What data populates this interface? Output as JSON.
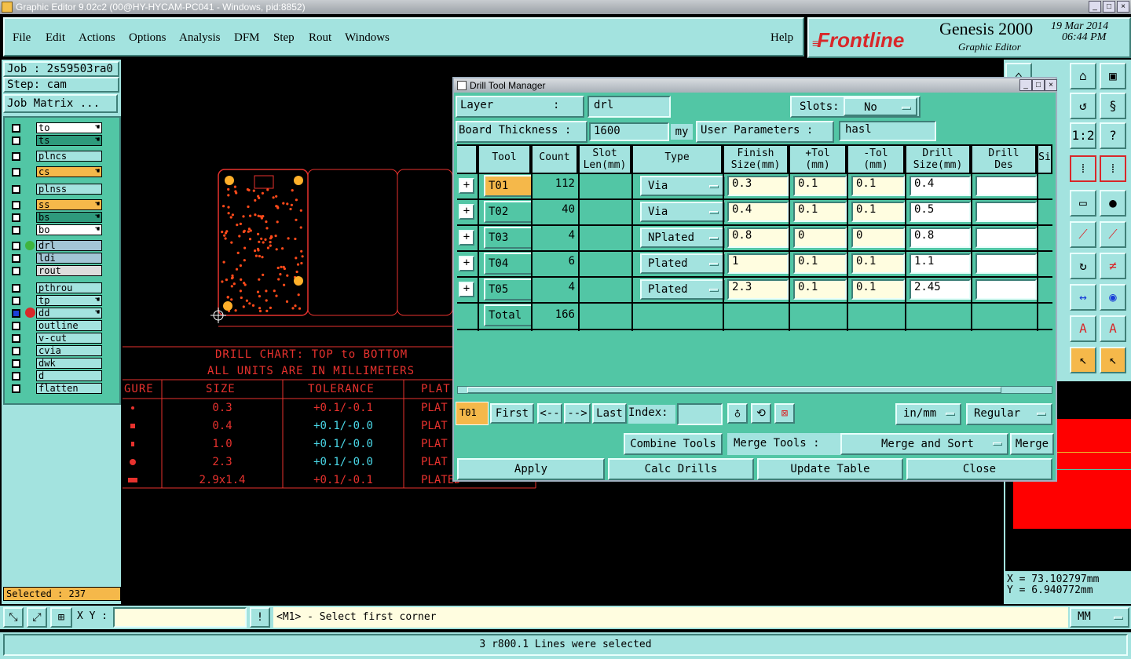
{
  "window": {
    "title": "Graphic Editor 9.02c2 (00@HY-HYCAM-PC041 - Windows, pid:8852)"
  },
  "menu": {
    "file": "File",
    "edit": "Edit",
    "actions": "Actions",
    "options": "Options",
    "analysis": "Analysis",
    "dfm": "DFM",
    "step": "Step",
    "rout": "Rout",
    "windows": "Windows",
    "help": "Help"
  },
  "brand": {
    "logo": "Frontline",
    "product": "Genesis 2000",
    "subtitle": "Graphic Editor",
    "date": "19 Mar 2014",
    "time": "06:44 PM"
  },
  "left": {
    "job": "Job : 2s59503ra0",
    "step": "Step: cam",
    "job_matrix": "Job Matrix ...",
    "selected": "Selected : 237",
    "layers": [
      {
        "name": "to",
        "color": "#ffffff"
      },
      {
        "name": "ts",
        "color": "#2e9a7c"
      },
      {
        "name": "plncs",
        "color": "#a3e3df"
      },
      {
        "name": "cs",
        "color": "#f5b84a"
      },
      {
        "name": "plnss",
        "color": "#a3e3df"
      },
      {
        "name": "ss",
        "color": "#f5b84a"
      },
      {
        "name": "bs",
        "color": "#2e9a7c"
      },
      {
        "name": "bo",
        "color": "#ffffff"
      },
      {
        "name": "drl",
        "color": "#a3c6d6"
      },
      {
        "name": "ldi",
        "color": "#a3c6d6"
      },
      {
        "name": "rout",
        "color": "#dddddd"
      },
      {
        "name": "pthrou",
        "color": "#a3e3df"
      },
      {
        "name": "tp",
        "color": "#a3e3df"
      },
      {
        "name": "dd",
        "color": "#a3e3df"
      },
      {
        "name": "outline",
        "color": "#a3e3df"
      },
      {
        "name": "v-cut",
        "color": "#a3e3df"
      },
      {
        "name": "cvia",
        "color": "#a3e3df"
      },
      {
        "name": "dwk",
        "color": "#a3e3df"
      },
      {
        "name": "d",
        "color": "#a3e3df"
      },
      {
        "name": "flatten",
        "color": "#a3e3df"
      }
    ]
  },
  "drill_chart": {
    "title1": "DRILL CHART: TOP to BOTTOM",
    "title2": "ALL UNITS ARE IN MILLIMETERS",
    "headers": [
      "GURE",
      "SIZE",
      "TOLERANCE",
      "PLAT"
    ],
    "rows": [
      {
        "size": "0.3",
        "tol": "+0.1/-0.1",
        "plat": "PLAT"
      },
      {
        "size": "0.4",
        "tol": "+0.1/-0.0",
        "plat": "PLAT"
      },
      {
        "size": "1.0",
        "tol": "+0.1/-0.0",
        "plat": "PLAT"
      },
      {
        "size": "2.3",
        "tol": "+0.1/-0.0",
        "plat": "PLAT"
      },
      {
        "size": "2.9x1.4",
        "tol": "+0.1/-0.1",
        "plat": "PLATED"
      }
    ]
  },
  "dialog": {
    "title": "Drill Tool Manager",
    "layer_label": "Layer         :",
    "layer_value": "drl",
    "slots_label": "Slots:",
    "slots_value": "No",
    "thickness_label": "Board Thickness :",
    "thickness_value": "1600",
    "thickness_unit": "my",
    "user_params_label": "User Parameters :",
    "user_params_value": "hasl",
    "headers": {
      "tool": "Tool",
      "count": "Count",
      "slot1": "Slot",
      "slot2": "Len(mm)",
      "type": "Type",
      "finish1": "Finish",
      "finish2": "Size(mm)",
      "ptol1": "+Tol",
      "ptol2": "(mm)",
      "mtol1": "-Tol",
      "mtol2": "(mm)",
      "drill1": "Drill",
      "drill2": "Size(mm)",
      "des1": "Drill",
      "des2": "Des",
      "si": "Si"
    },
    "rows": [
      {
        "tool": "T01",
        "count": "112",
        "type": "Via",
        "finish": "0.3",
        "ptol": "0.1",
        "mtol": "0.1",
        "drill": "0.4",
        "des": ""
      },
      {
        "tool": "T02",
        "count": "40",
        "type": "Via",
        "finish": "0.4",
        "ptol": "0.1",
        "mtol": "0.1",
        "drill": "0.5",
        "des": ""
      },
      {
        "tool": "T03",
        "count": "4",
        "type": "NPlated",
        "finish": "0.8",
        "ptol": "0",
        "mtol": "0",
        "drill": "0.8",
        "des": ""
      },
      {
        "tool": "T04",
        "count": "6",
        "type": "Plated",
        "finish": "1",
        "ptol": "0.1",
        "mtol": "0.1",
        "drill": "1.1",
        "des": ""
      },
      {
        "tool": "T05",
        "count": "4",
        "type": "Plated",
        "finish": "2.3",
        "ptol": "0.1",
        "mtol": "0.1",
        "drill": "2.45",
        "des": ""
      }
    ],
    "total_label": "Total",
    "total_count": "166",
    "nav": {
      "current": "T01",
      "first": "First",
      "prev": "<--",
      "next": "-->",
      "last": "Last",
      "index_label": "Index:",
      "index_value": "",
      "units": "in/mm",
      "mode": "Regular"
    },
    "combine": "Combine Tools",
    "merge_label": "Merge Tools :",
    "merge_value": "Merge and Sort",
    "merge_btn": "Merge",
    "apply": "Apply",
    "calc": "Calc Drills",
    "update": "Update Table",
    "close": "Close"
  },
  "coords": {
    "x": "X = 73.102797mm",
    "y": "Y = 6.940772mm"
  },
  "bottom": {
    "xy_label": "X Y :",
    "xy_value": "",
    "prompt": "<M1> - Select first corner",
    "units": "MM",
    "status": "3 r800.1 Lines were selected"
  }
}
